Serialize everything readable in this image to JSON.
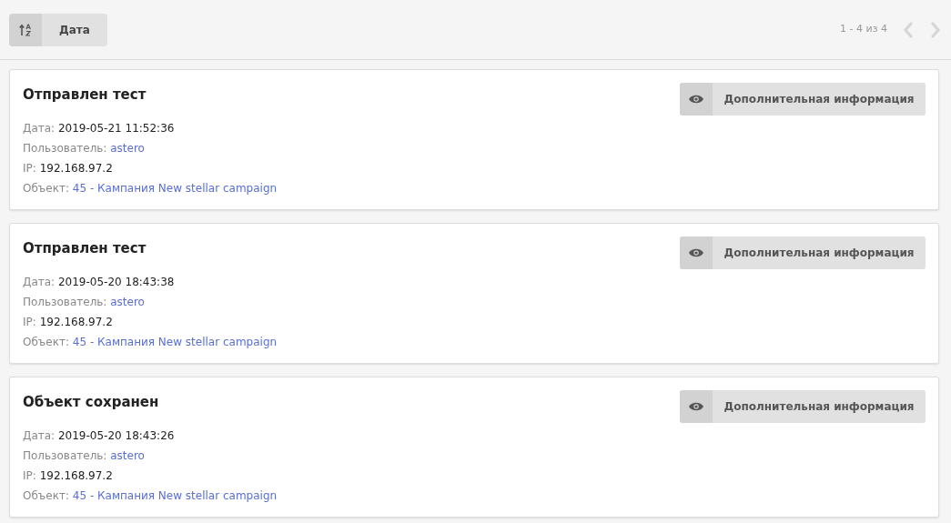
{
  "toolbar": {
    "sort_button": {
      "label": "Дата"
    },
    "pagination": {
      "range": "1 - 4 из 4",
      "prev_disabled": true,
      "next_disabled": true
    }
  },
  "events": [
    {
      "title": "Отправлен тест",
      "button": "Дополнительная информация",
      "fields": [
        {
          "label": "Дата:",
          "value": "2019-05-21 11:52:36",
          "kind": "text"
        },
        {
          "label": "Пользователь:",
          "value": "astero",
          "kind": "link"
        },
        {
          "label": "IP:",
          "value": "192.168.97.2",
          "kind": "text"
        },
        {
          "label": "Объект:",
          "value": "45 - Кампания New stellar campaign",
          "kind": "link"
        }
      ]
    },
    {
      "title": "Отправлен тест",
      "button": "Дополнительная информация",
      "fields": [
        {
          "label": "Дата:",
          "value": "2019-05-20 18:43:38",
          "kind": "text"
        },
        {
          "label": "Пользователь:",
          "value": "astero",
          "kind": "link"
        },
        {
          "label": "IP:",
          "value": "192.168.97.2",
          "kind": "text"
        },
        {
          "label": "Объект:",
          "value": "45 - Кампания New stellar campaign",
          "kind": "link"
        }
      ]
    },
    {
      "title": "Объект сохранен",
      "button": "Дополнительная информация",
      "fields": [
        {
          "label": "Дата:",
          "value": "2019-05-20 18:43:26",
          "kind": "text"
        },
        {
          "label": "Пользователь:",
          "value": "astero",
          "kind": "link"
        },
        {
          "label": "IP:",
          "value": "192.168.97.2",
          "kind": "text"
        },
        {
          "label": "Объект:",
          "value": "45 - Кампания New stellar campaign",
          "kind": "link"
        }
      ]
    }
  ]
}
